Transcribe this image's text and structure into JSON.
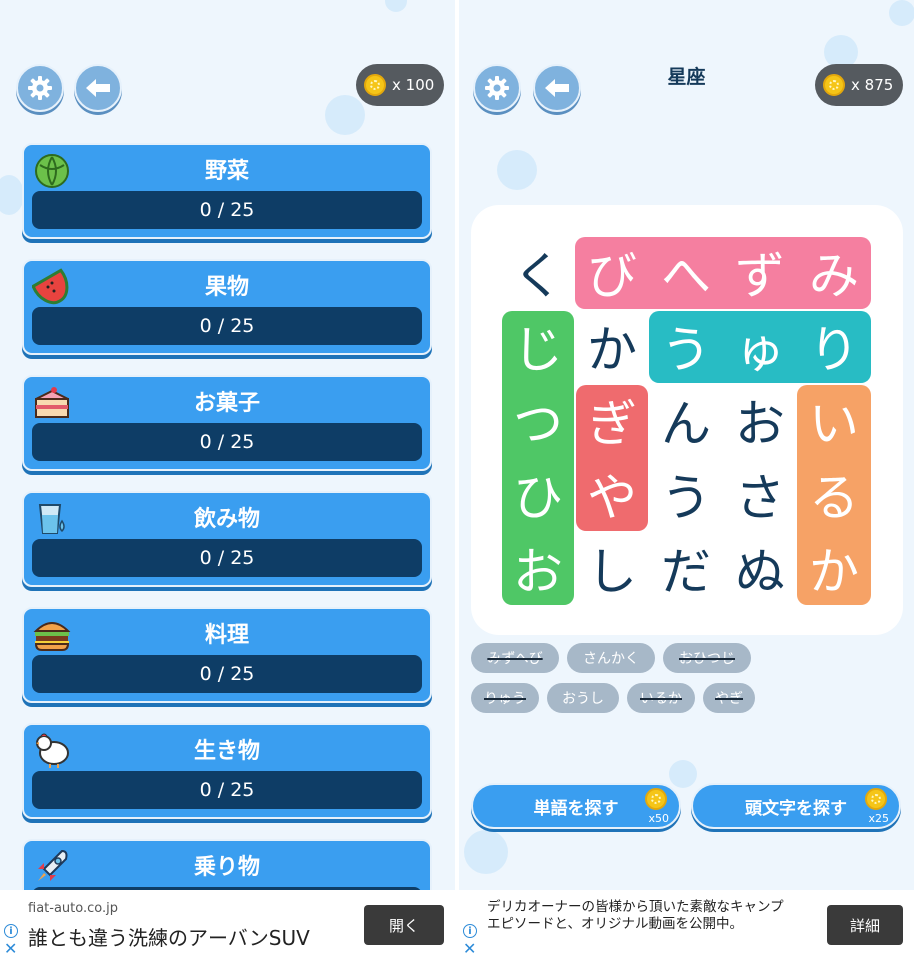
{
  "left": {
    "coins_label": "x 100",
    "categories": [
      {
        "title": "野菜",
        "progress": "0 / 25",
        "icon": "cabbage-icon"
      },
      {
        "title": "果物",
        "progress": "0 / 25",
        "icon": "watermelon-icon"
      },
      {
        "title": "お菓子",
        "progress": "0 / 25",
        "icon": "cake-icon"
      },
      {
        "title": "飲み物",
        "progress": "0 / 25",
        "icon": "water-glass-icon"
      },
      {
        "title": "料理",
        "progress": "0 / 25",
        "icon": "burger-icon"
      },
      {
        "title": "生き物",
        "progress": "0 / 25",
        "icon": "chicken-icon"
      },
      {
        "title": "乗り物",
        "progress": "",
        "icon": "rocket-icon"
      }
    ],
    "ad": {
      "domain": "fiat-auto.co.jp",
      "headline": "誰とも違う洗練のアーバンSUV",
      "button": "開く"
    }
  },
  "right": {
    "title": "星座",
    "coins_label": "x 875",
    "grid": [
      [
        "く",
        "び",
        "へ",
        "ず",
        "み"
      ],
      [
        "じ",
        "か",
        "う",
        "ゅ",
        "り"
      ],
      [
        "つ",
        "ぎ",
        "ん",
        "お",
        "い"
      ],
      [
        "ひ",
        "や",
        "う",
        "さ",
        "る"
      ],
      [
        "お",
        "し",
        "だ",
        "ぬ",
        "か"
      ]
    ],
    "highlight_colors": {
      "pink": "#f57fa0",
      "teal": "#28bcc4",
      "green": "#4fc766",
      "red": "#ef6b6e",
      "orange": "#f6a266"
    },
    "words_row1": [
      {
        "text": "みずへび",
        "found": true
      },
      {
        "text": "さんかく",
        "found": false
      },
      {
        "text": "おひつじ",
        "found": true
      }
    ],
    "words_row2": [
      {
        "text": "りゅう",
        "found": true
      },
      {
        "text": "おうし",
        "found": false
      },
      {
        "text": "いるか",
        "found": true
      },
      {
        "text": "やぎ",
        "found": true
      }
    ],
    "hint_word": {
      "label": "単語を探す",
      "cost": "x50"
    },
    "hint_letter": {
      "label": "頭文字を探す",
      "cost": "x25"
    },
    "ad": {
      "text": "デリカオーナーの皆様から頂いた素敵なキャンプエピソードと、オリジナル動画を公開中。",
      "button": "詳細"
    }
  },
  "colors": {
    "card": "#3a9ef0",
    "bar": "#0e3d66",
    "background": "#eef6fd"
  }
}
